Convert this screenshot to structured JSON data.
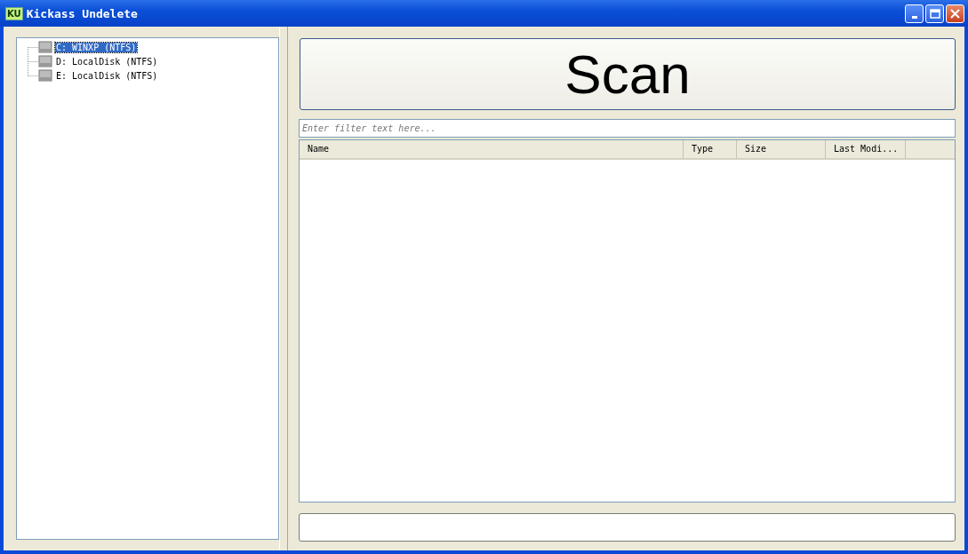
{
  "window": {
    "title": "Kickass Undelete",
    "app_icon": "KU"
  },
  "drives": [
    {
      "label": "C: WINXP (NTFS)",
      "selected": true
    },
    {
      "label": "D: LocalDisk (NTFS)",
      "selected": false
    },
    {
      "label": "E: LocalDisk (NTFS)",
      "selected": false
    }
  ],
  "scan_button": "Scan",
  "filter": {
    "placeholder": "Enter filter text here..."
  },
  "table": {
    "columns": [
      "Name",
      "Type",
      "Size",
      "Last Modi..."
    ]
  }
}
